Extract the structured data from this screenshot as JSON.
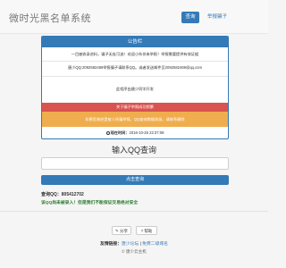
{
  "navbar": {
    "brand": "微时光黑名单系统",
    "query_button": "查询",
    "report_button": "举报骗子"
  },
  "notice": {
    "header": "公告栏",
    "line1": "一目被收录进料，骗子无处可逃！欢迎小伙伴来举报！举报需要提供有效证据",
    "line2": "唐少QQ:2092582469举报骗子请联系QQ。或者发送邮件至2092582469@qq.com",
    "line3": "此程序由唐少同学开发",
    "alert_red": "关于骗子举报成功频繁",
    "alert_orange": "如果您曾经是被人所骗举报，QQ查询数据收录，请联系删除",
    "time_label": "现在时间：",
    "time_value": "2016-10-26 22:37:08"
  },
  "query": {
    "title": "输入QQ查询",
    "input_value": "",
    "input_placeholder": "",
    "button": "点击查询"
  },
  "result": {
    "qq_line": "查询QQ：805412702",
    "message": "该QQ尚未被录入！但是我们不能保证交易绝对安全"
  },
  "footer": {
    "share_button": "分享",
    "help_button": "帮助",
    "links_label": "友情链接：",
    "link1": "唐少论坛",
    "link_sep": "|",
    "link2": "免费二级域名",
    "copyright": "© 唐少云主机"
  },
  "colors": {
    "primary": "#337ab7",
    "danger": "#d9534f",
    "warning": "#f0ad4e",
    "success": "#2e7d32"
  }
}
